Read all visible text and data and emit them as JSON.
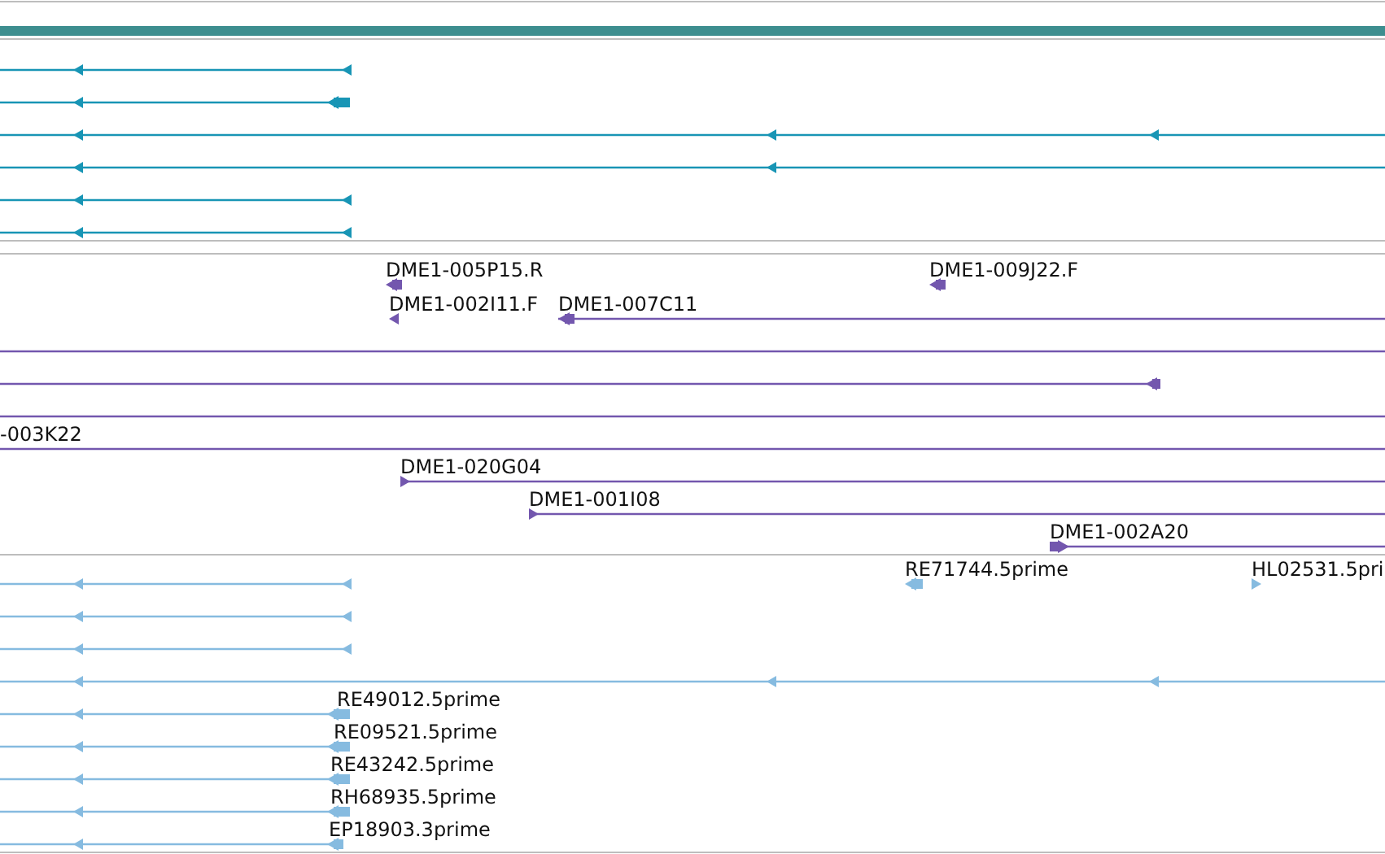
{
  "tracks": [
    {
      "color": "#1895b5",
      "rows": [
        {
          "features": [
            {
              "kind": "arrow",
              "forward": false
            }
          ]
        },
        {
          "features": [
            {
              "kind": "arrow",
              "forward": false
            }
          ]
        },
        {
          "features": [
            {
              "kind": "arrow",
              "forward": false
            }
          ]
        },
        {
          "features": [
            {
              "kind": "arrow",
              "forward": false
            }
          ]
        },
        {
          "features": [
            {
              "kind": "arrow",
              "forward": false
            }
          ]
        },
        {
          "features": [
            {
              "kind": "arrow",
              "forward": false
            }
          ]
        }
      ]
    },
    {
      "color": "#7357ae",
      "rows": [
        {
          "features": [
            {
              "kind": "arrow",
              "label": "DME1-005P15.R",
              "forward": false
            },
            {
              "kind": "arrow",
              "label": "DME1-009J22.F",
              "forward": false
            }
          ]
        },
        {
          "features": [
            {
              "kind": "arrow",
              "label": "DME1-002I11.F",
              "forward": false
            },
            {
              "kind": "arrow",
              "label": "DME1-007C11",
              "forward": false
            }
          ]
        },
        {
          "features": [
            {
              "kind": "plain"
            }
          ]
        },
        {
          "features": [
            {
              "kind": "arrow",
              "forward": false
            }
          ]
        },
        {
          "features": [
            {
              "kind": "plain"
            }
          ]
        },
        {
          "features": [
            {
              "kind": "plain",
              "label": "-003K22"
            }
          ]
        },
        {
          "features": [
            {
              "kind": "arrow",
              "label": "DME1-020G04",
              "forward": true
            }
          ]
        },
        {
          "features": [
            {
              "kind": "arrow",
              "label": "DME1-001I08",
              "forward": true
            }
          ]
        },
        {
          "features": [
            {
              "kind": "arrow",
              "label": "DME1-002A20",
              "forward": true
            }
          ]
        }
      ]
    },
    {
      "color": "#86bbe0",
      "rows": [
        {
          "features": [
            {
              "kind": "arrow",
              "forward": false
            },
            {
              "kind": "arrow",
              "label": "RE71744.5prime",
              "forward": false
            },
            {
              "kind": "arrow",
              "label": "HL02531.5pri",
              "forward": true
            }
          ]
        },
        {
          "features": [
            {
              "kind": "arrow",
              "forward": false
            }
          ]
        },
        {
          "features": [
            {
              "kind": "arrow",
              "forward": false
            }
          ]
        },
        {
          "features": [
            {
              "kind": "arrow",
              "forward": false
            }
          ]
        },
        {
          "features": [
            {
              "kind": "arrow",
              "label": "RE49012.5prime",
              "forward": false
            }
          ]
        },
        {
          "features": [
            {
              "kind": "arrow",
              "label": "RE09521.5prime",
              "forward": false
            }
          ]
        },
        {
          "features": [
            {
              "kind": "arrow",
              "label": "RE43242.5prime",
              "forward": false
            }
          ]
        },
        {
          "features": [
            {
              "kind": "arrow",
              "label": "RH68935.5prime",
              "forward": false
            }
          ]
        },
        {
          "features": [
            {
              "kind": "arrow",
              "label": "EP18903.3prime",
              "forward": false
            }
          ]
        }
      ]
    }
  ]
}
